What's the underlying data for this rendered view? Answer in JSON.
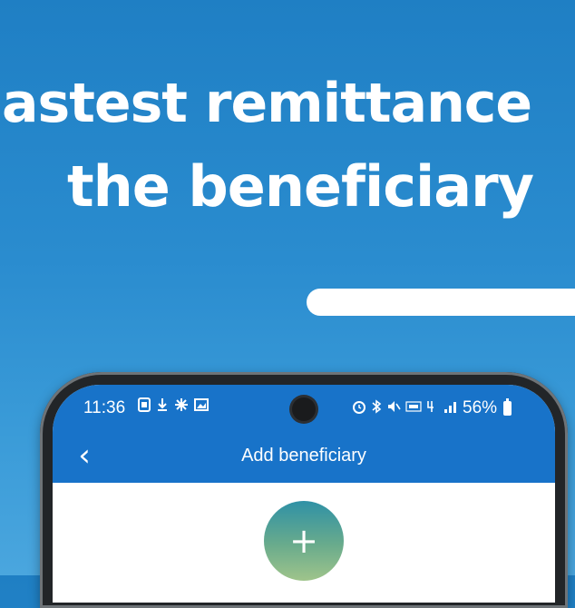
{
  "banner": {
    "line1": "astest remittance",
    "line2": "the beneficiary"
  },
  "status_bar": {
    "time": "11:36",
    "left_icons": [
      "notification-icon",
      "download-icon",
      "fan-icon",
      "image-icon"
    ],
    "right_icons": [
      "alarm-icon",
      "bluetooth-icon",
      "mute-icon",
      "volte-icon",
      "4g-icon",
      "signal-icon"
    ],
    "battery": "56%"
  },
  "app_header": {
    "back_glyph": "‹",
    "title": "Add beneficiary"
  },
  "content": {
    "add_glyph": "+"
  },
  "colors": {
    "background": "#2a8ccf",
    "app_bar": "#1873c9",
    "add_button_top": "#2f91a6",
    "add_button_bottom": "#9fc48b"
  }
}
